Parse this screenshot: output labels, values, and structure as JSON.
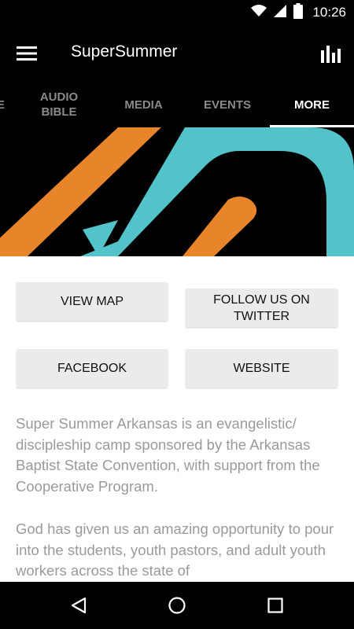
{
  "status_bar": {
    "time": "10:26",
    "icons": [
      "wifi-icon",
      "signal-icon",
      "battery-icon"
    ]
  },
  "app_bar": {
    "title": "SuperSummer",
    "menu_icon": "hamburger-menu-icon",
    "action_icon": "bar-chart-icon"
  },
  "tabs": [
    {
      "label": "E",
      "active": false
    },
    {
      "label": "AUDIO BIBLE",
      "active": false
    },
    {
      "label": "MEDIA",
      "active": false
    },
    {
      "label": "EVENTS",
      "active": false
    },
    {
      "label": "MORE",
      "active": true
    }
  ],
  "banner": {
    "colors": {
      "orange": "#e8852a",
      "teal": "#52c3c9",
      "background": "#000000"
    }
  },
  "buttons": {
    "view_map": "VIEW MAP",
    "follow_twitter": "FOLLOW US ON TWITTER",
    "facebook": "FACEBOOK",
    "website": "WEBSITE"
  },
  "description": {
    "paragraph1": "Super Summer Arkansas is an evangelistic/ discipleship camp sponsored by the Arkansas Baptist State Convention, with support from the Cooperative Program.",
    "paragraph2": "God has given us an amazing opportunity to pour into the students, youth pastors, and adult youth workers across the state of"
  },
  "nav_bar": {
    "icons": [
      "back-icon",
      "home-icon",
      "recents-icon"
    ]
  }
}
